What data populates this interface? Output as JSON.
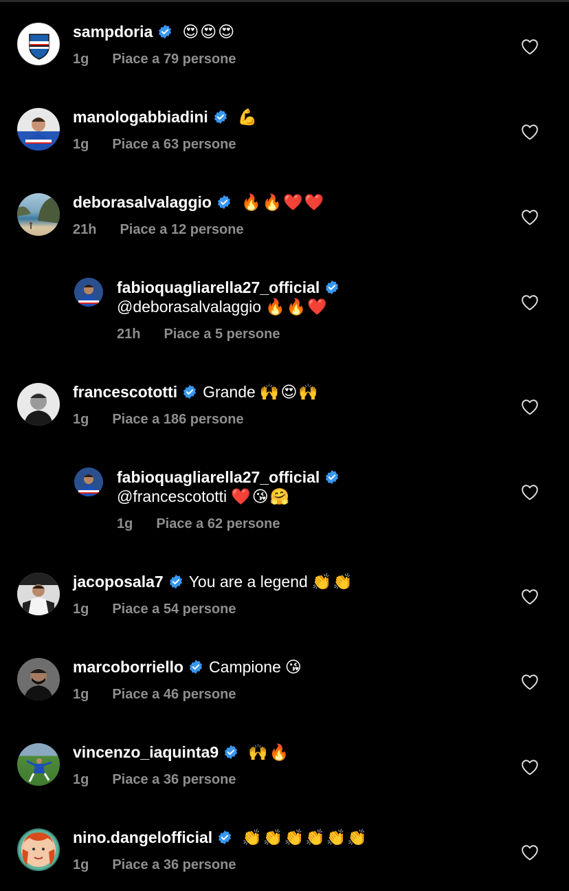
{
  "comments": [
    {
      "username": "sampdoria",
      "text": "",
      "emoji": "😍😍😍",
      "time": "1g",
      "likes": "Piace a 79 persone",
      "avatar": "sampdoria-logo"
    },
    {
      "username": "manologabbiadini",
      "text": "",
      "emoji": "💪",
      "time": "1g",
      "likes": "Piace a 63 persone",
      "avatar": "player-photo"
    },
    {
      "username": "deborasalvalaggio",
      "text": "",
      "emoji": "🔥🔥❤️❤️",
      "time": "21h",
      "likes": "Piace a 12 persone",
      "avatar": "beach-photo"
    },
    {
      "username": "fabioquagliarella27_official",
      "mention": "@deborasalvalaggio",
      "emoji": "🔥🔥❤️",
      "time": "21h",
      "likes": "Piace a 5 persone",
      "reply": true,
      "avatar": "player-photo"
    },
    {
      "username": "francescototti",
      "text": "Grande",
      "emoji": "🙌😍🙌",
      "time": "1g",
      "likes": "Piace a 186 persone",
      "avatar": "bw-portrait"
    },
    {
      "username": "fabioquagliarella27_official",
      "mention": "@francescototti",
      "emoji": "❤️😘🤗",
      "time": "1g",
      "likes": "Piace a 62 persone",
      "reply": true,
      "avatar": "player-photo"
    },
    {
      "username": "jacoposala7",
      "text": "You are a legend",
      "emoji": "👏👏",
      "time": "1g",
      "likes": "Piace a 54 persone",
      "avatar": "player-photo"
    },
    {
      "username": "marcoborriello",
      "text": "Campione",
      "emoji": "😘",
      "time": "1g",
      "likes": "Piace a 46 persone",
      "avatar": "masked-portrait"
    },
    {
      "username": "vincenzo_iaquinta9",
      "text": "",
      "emoji": "🙌🔥",
      "time": "1g",
      "likes": "Piace a 36 persone",
      "avatar": "pitch-photo"
    },
    {
      "username": "nino.dangelofficial",
      "text": "",
      "emoji": "👏👏👏👏👏👏",
      "time": "1g",
      "likes": "Piace a 36 persone",
      "avatar": "cartoon-portrait"
    }
  ],
  "colors": {
    "background": "#000000",
    "text": "#ffffff",
    "muted": "#8e8e8e",
    "verified": "#3897f0"
  },
  "icons": {
    "verified": "verified-badge-icon",
    "like": "heart-outline-icon"
  }
}
